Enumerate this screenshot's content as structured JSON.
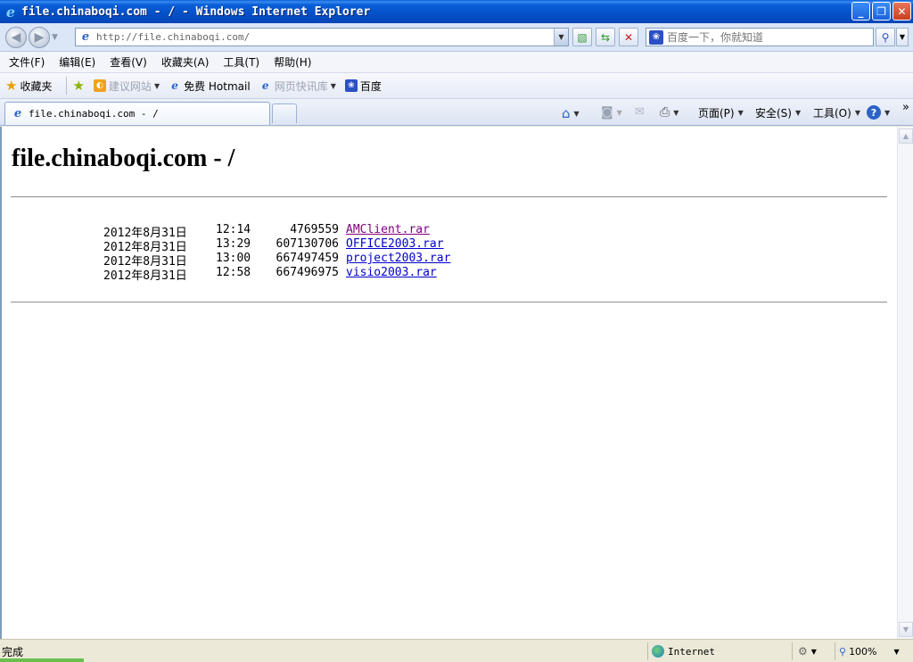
{
  "window": {
    "title": "file.chinaboqi.com - / - Windows Internet Explorer"
  },
  "address": {
    "url": "http://file.chinaboqi.com/"
  },
  "search": {
    "placeholder": "百度一下，你就知道"
  },
  "menu": [
    "文件(F)",
    "编辑(E)",
    "查看(V)",
    "收藏夹(A)",
    "工具(T)",
    "帮助(H)"
  ],
  "favorites": {
    "label": "收藏夹",
    "items": [
      "建议网站",
      "免费 Hotmail",
      "网页快讯库",
      "百度"
    ]
  },
  "tab": {
    "label": "file.chinaboqi.com - /"
  },
  "commands": {
    "page": "页面(P)",
    "safety": "安全(S)",
    "tools": "工具(O)"
  },
  "page": {
    "heading": "file.chinaboqi.com - /",
    "files": [
      {
        "date": "2012年8月31日",
        "time": "12:14",
        "size": "4769559",
        "name": "AMClient.rar",
        "visited": true
      },
      {
        "date": "2012年8月31日",
        "time": "13:29",
        "size": "607130706",
        "name": "OFFICE2003.rar",
        "visited": false
      },
      {
        "date": "2012年8月31日",
        "time": "13:00",
        "size": "667497459",
        "name": "project2003.rar",
        "visited": false
      },
      {
        "date": "2012年8月31日",
        "time": "12:58",
        "size": "667496975",
        "name": "visio2003.rar",
        "visited": false
      }
    ]
  },
  "status": {
    "text": "完成",
    "zone": "Internet",
    "zoom": "100%"
  }
}
